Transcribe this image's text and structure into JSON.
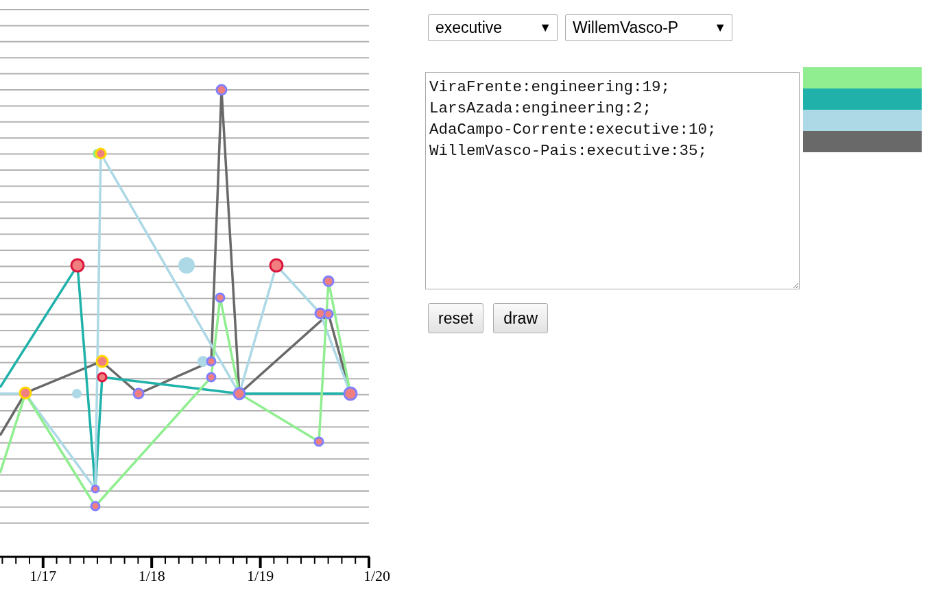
{
  "chart": {
    "kind": "picture",
    "axis_labels": [
      "1/17",
      "1/18",
      "1/19",
      "1/20"
    ]
  },
  "dropdowns": [
    {
      "value": "executive",
      "caret": "▼"
    },
    {
      "value": "WillemVasco-P",
      "caret": "▼"
    }
  ],
  "text_area": {
    "value": "ViraFrente:engineering:19;\nLarsAzada:engineering:2;\nAdaCampo-Corrente:executive:10;\nWillemVasco-Pais:executive:35;"
  },
  "legend": [
    {
      "color": "#90ee90"
    },
    {
      "color": "#20b2aa"
    },
    {
      "color": "#add8e6"
    },
    {
      "color": "#696969"
    }
  ],
  "buttons": [
    "reset",
    "draw"
  ]
}
